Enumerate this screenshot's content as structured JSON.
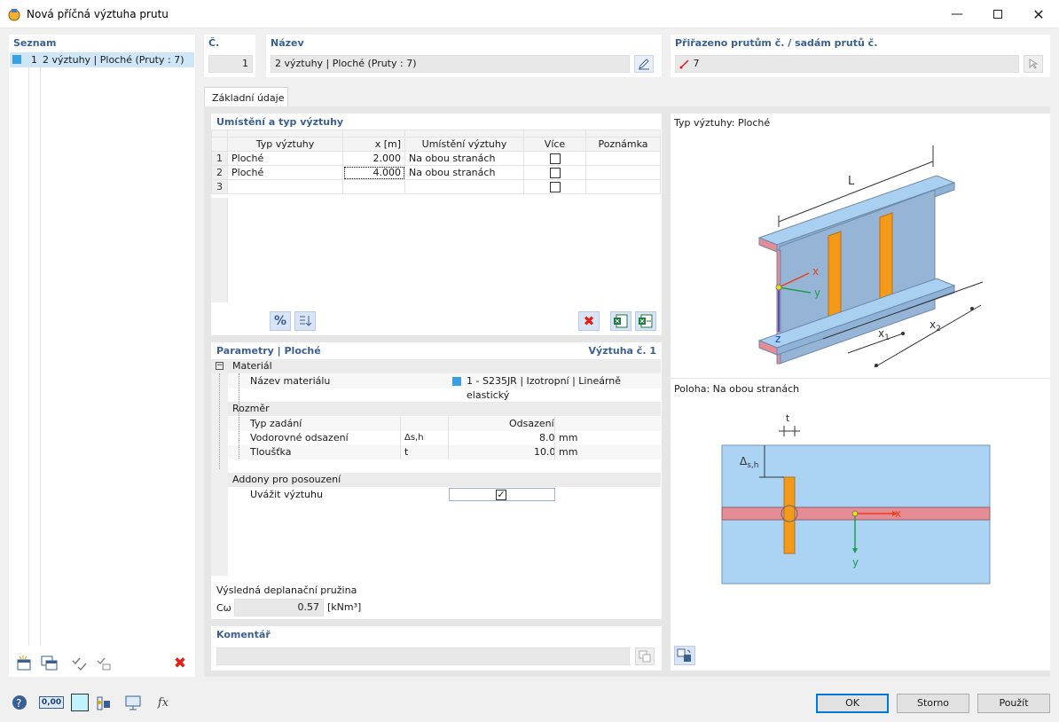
{
  "window": {
    "title": "Nová příčná výztuha prutu"
  },
  "list": {
    "header": "Seznam",
    "items": [
      {
        "num": "1",
        "label": "2 výztuhy | Ploché (Pruty : 7)",
        "color": "#39a0e6"
      }
    ]
  },
  "number": {
    "label": "Č.",
    "value": "1"
  },
  "name": {
    "label": "Název",
    "value": "2 výztuhy | Ploché (Pruty : 7)"
  },
  "assigned": {
    "label": "Přiřazeno prutům č. / sadám prutů č.",
    "value": "7"
  },
  "tab": {
    "label": "Základní údaje"
  },
  "placement": {
    "header": "Umístění a typ výztuhy",
    "columns": [
      "Typ výztuhy",
      "x [m]",
      "Umístění výztuhy",
      "Více",
      "Poznámka"
    ],
    "rows": [
      {
        "num": "1",
        "type": "Ploché",
        "x": "2.000",
        "placement": "Na obou stranách",
        "more": false,
        "note": ""
      },
      {
        "num": "2",
        "type": "Ploché",
        "x": "4.000",
        "placement": "Na obou stranách",
        "more": false,
        "note": ""
      },
      {
        "num": "3",
        "type": "",
        "x": "",
        "placement": "",
        "more": false,
        "note": ""
      }
    ]
  },
  "params": {
    "header": "Parametry | Ploché",
    "header_right": "Výztuha č. 1",
    "material_group": "Materiál",
    "material_name_label": "Název materiálu",
    "material_value": "1 - S235JR | Izotropní | Lineárně elastický",
    "material_color": "#39a0e6",
    "dim_group": "Rozměr",
    "input_type_label": "Typ zadání",
    "input_type_value": "Odsazení",
    "h_offset_label": "Vodorovné odsazení",
    "h_offset_sym": "Δs,h",
    "h_offset_value": "8.0",
    "h_offset_unit": "mm",
    "thickness_label": "Tloušťka",
    "thickness_sym": "t",
    "thickness_value": "10.0",
    "thickness_unit": "mm",
    "addons_group": "Addony pro posouzení",
    "consider_label": "Uvážit výztuhu",
    "consider_checked": true
  },
  "spring": {
    "label": "Výsledná deplanační pružina",
    "sym": "Cω",
    "value": "0.57",
    "unit": "[kNm³]"
  },
  "comment": {
    "label": "Komentář",
    "value": ""
  },
  "preview": {
    "type_label": "Typ výztuhy: Ploché",
    "position_label": "Poloha: Na obou stranách",
    "iso": {
      "L": "L",
      "x": "x",
      "y": "y",
      "z": "z",
      "x1": "x",
      "x1_sub": "1",
      "x2": "x",
      "x2_sub": "2"
    },
    "section": {
      "t": "t",
      "ds": "Δ",
      "ds_sub": "s,h",
      "x": "x",
      "y": "y"
    }
  },
  "buttons": {
    "ok": "OK",
    "cancel": "Storno",
    "apply": "Použít"
  },
  "icons": {
    "percent": "%",
    "zero_value": "0,00",
    "fx": "fx",
    "delete_color": "#e0201a",
    "accent": "#3a5f93"
  }
}
